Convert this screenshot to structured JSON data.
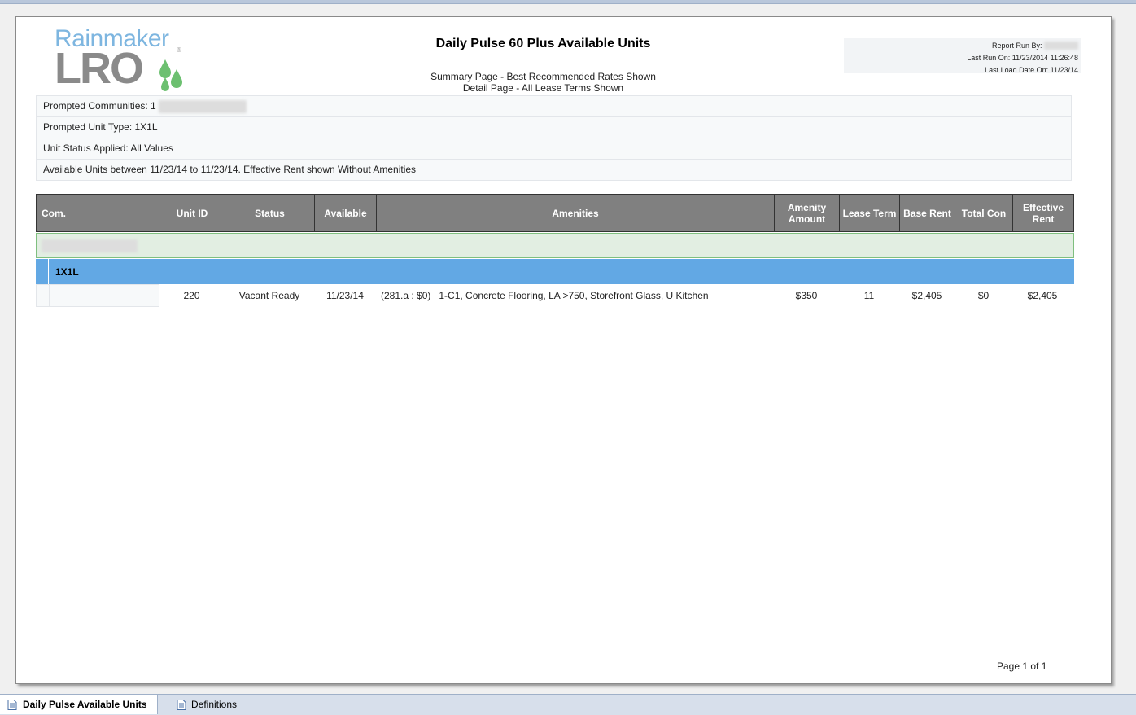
{
  "report": {
    "title": "Daily Pulse 60 Plus Available Units",
    "subtitle_1": "Summary Page - Best Recommended Rates Shown",
    "subtitle_2": "Detail Page - All Lease Terms Shown"
  },
  "logo": {
    "top": "Rainmaker",
    "bottom": "LRO",
    "reg": "®"
  },
  "run_info": {
    "run_by_label": "Report Run By:",
    "last_run": "Last Run On: 11/23/2014 11:26:48",
    "last_load": "Last Load Date On: 11/23/14"
  },
  "params": {
    "communities_label": "Prompted Communities: 1",
    "unit_type": "Prompted Unit Type: 1X1L",
    "unit_status": "Unit Status Applied: All Values",
    "available": "Available Units between 11/23/14 to 11/23/14. Effective Rent shown Without Amenities"
  },
  "columns": {
    "com": "Com.",
    "unit_id": "Unit ID",
    "status": "Status",
    "available": "Available",
    "amenities": "Amenities",
    "amenity_amount": "Amenity Amount",
    "lease_term": "Lease Term",
    "base_rent": "Base Rent",
    "total_con": "Total Con",
    "effective_rent": "Effective Rent"
  },
  "group": {
    "unit_type": "1X1L"
  },
  "rows": [
    {
      "unit_id": "220",
      "status": "Vacant Ready",
      "available": "11/23/14",
      "amenities": "(281.a : $0)   1-C1, Concrete Flooring, LA >750, Storefront Glass, U Kitchen",
      "amenity_amount": "$350",
      "lease_term": "11",
      "base_rent": "$2,405",
      "total_con": "$0",
      "effective_rent": "$2,405"
    }
  ],
  "pager": "Page 1 of 1",
  "tabs": {
    "active": "Daily Pulse Available Units",
    "second": "Definitions"
  },
  "colors": {
    "header_bg": "#808080",
    "group_bg": "#e2eee2",
    "unittype_bg": "#62a8e4",
    "logo_blue": "#7eb6e0",
    "logo_gray": "#8a8a8a",
    "drop_green": "#6cc070"
  }
}
